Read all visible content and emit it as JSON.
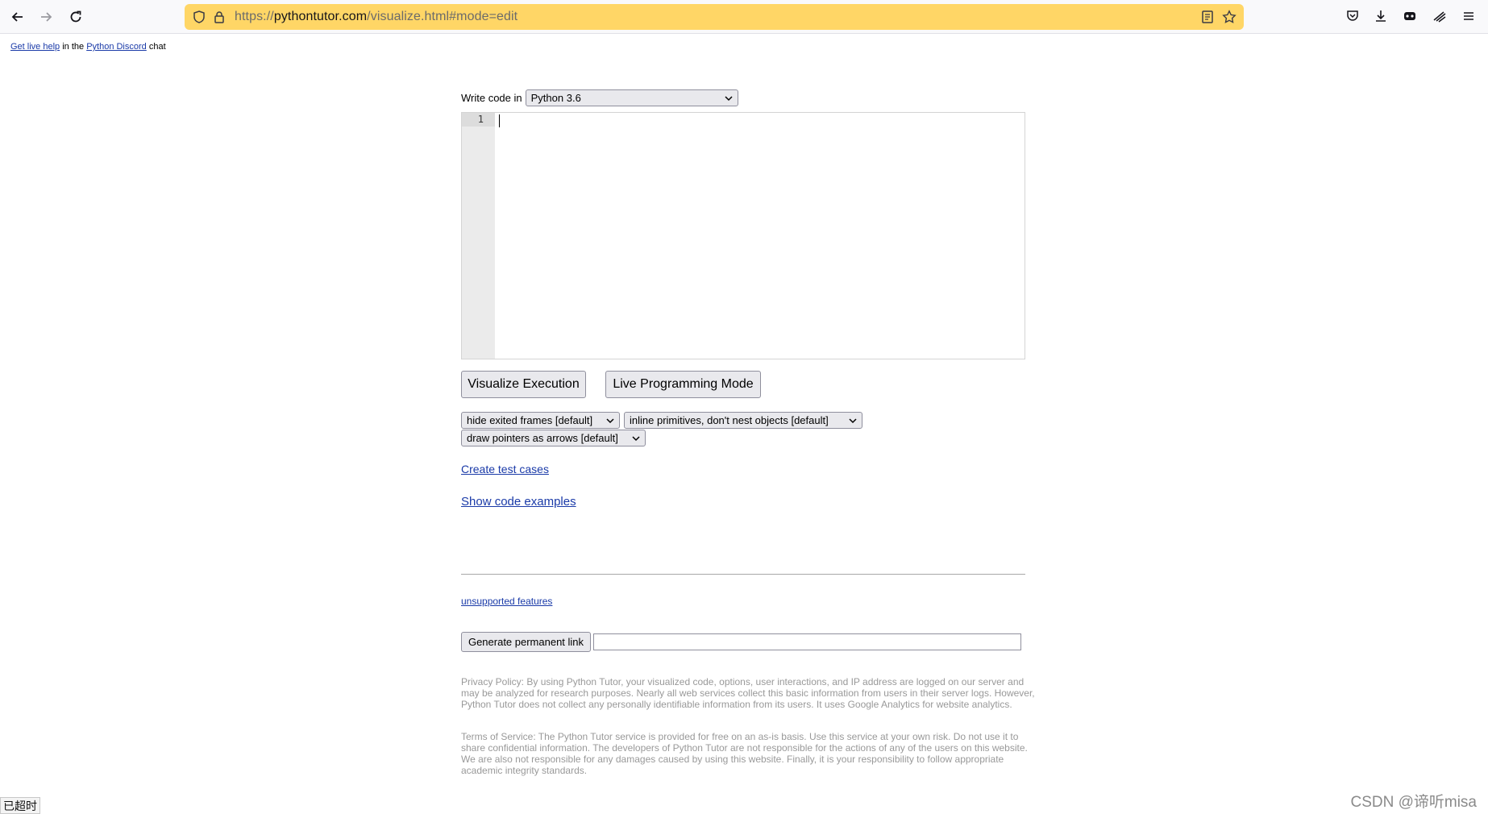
{
  "browser": {
    "url_prefix": "https://",
    "url_domain": "pythontutor.com",
    "url_path": "/visualize.html#mode=edit"
  },
  "help": {
    "link1": "Get live help",
    "text1": " in the ",
    "link2": "Python Discord",
    "text2": " chat"
  },
  "editor": {
    "label": "Write code in",
    "language": "Python 3.6",
    "line_number": "1"
  },
  "buttons": {
    "visualize": "Visualize Execution",
    "live": "Live Programming Mode",
    "permalink": "Generate permanent link"
  },
  "options": {
    "frames": "hide exited frames [default]",
    "primitives": "inline primitives, don't nest objects [default]",
    "pointers": "draw pointers as arrows [default]"
  },
  "links": {
    "test_cases": "Create test cases",
    "examples": "Show code examples",
    "unsupported": "unsupported features"
  },
  "legal": {
    "privacy": "Privacy Policy: By using Python Tutor, your visualized code, options, user interactions, and IP address are logged on our server and may be analyzed for research purposes. Nearly all web services collect this basic information from users in their server logs. However, Python Tutor does not collect any personally identifiable information from its users. It uses Google Analytics for website analytics.",
    "terms": "Terms of Service: The Python Tutor service is provided for free on an as-is basis. Use this service at your own risk. Do not use it to share confidential information. The developers of Python Tutor are not responsible for the actions of any of the users on this website. We are also not responsible for any damages caused by using this website. Finally, it is your responsibility to follow appropriate academic integrity standards."
  },
  "status": {
    "timeout": "已超时"
  },
  "watermark": "CSDN @谛听misa"
}
